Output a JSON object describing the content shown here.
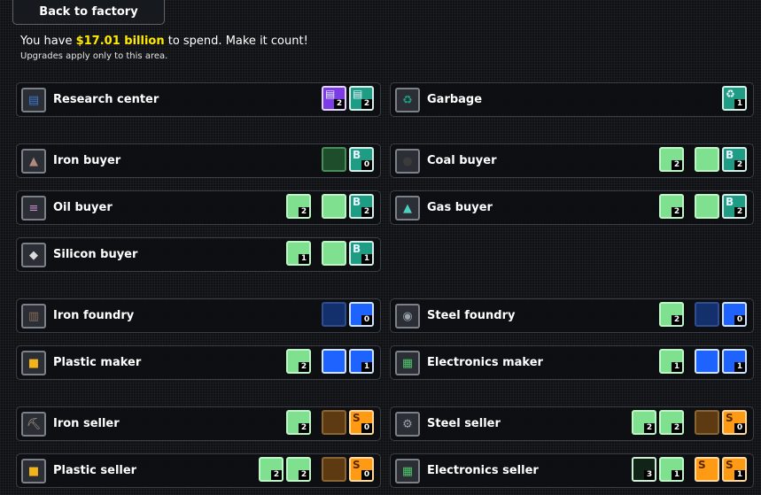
{
  "back_button": "Back to factory",
  "budget": {
    "prefix": "You have ",
    "amount": "$17.01 billion",
    "suffix": " to spend. Make it count!",
    "note": "Upgrades apply only to this area."
  },
  "cards": [
    {
      "name": "Research center",
      "icon": "research-center-icon",
      "symbol": "▤",
      "color": "#3a78d8",
      "upgrades": [
        {
          "style": "purple",
          "glyph": "▤",
          "badge": "2"
        },
        {
          "style": "teal",
          "glyph": "▤",
          "badge": "2"
        }
      ]
    },
    {
      "name": "Garbage",
      "icon": "recycle-icon",
      "symbol": "♻",
      "color": "#1f9d84",
      "upgrades": [
        {
          "style": "teal",
          "glyph": "♻",
          "badge": "1"
        }
      ]
    },
    {
      "name": "Iron buyer",
      "icon": "iron-ore-icon",
      "symbol": "▲",
      "color": "#b08a7a",
      "upgrades": [
        {
          "style": "dgreen",
          "glyph": "",
          "badge": ""
        },
        {
          "style": "teal",
          "glyph": "B",
          "badge": "0"
        }
      ]
    },
    {
      "name": "Coal buyer",
      "icon": "coal-icon",
      "symbol": "●",
      "color": "#3b3b3b",
      "upgrades": [
        {
          "style": "green",
          "glyph": "",
          "badge": "2"
        },
        {
          "style": "green",
          "glyph": "",
          "badge": "",
          "gap": true
        },
        {
          "style": "teal",
          "glyph": "B",
          "badge": "2"
        }
      ]
    },
    {
      "name": "Oil buyer",
      "icon": "oil-barrel-icon",
      "symbol": "≡",
      "color": "#c48cd0",
      "upgrades": [
        {
          "style": "green",
          "glyph": "",
          "badge": "2"
        },
        {
          "style": "green",
          "glyph": "",
          "badge": "",
          "gap": true
        },
        {
          "style": "teal",
          "glyph": "B",
          "badge": "2"
        }
      ]
    },
    {
      "name": "Gas buyer",
      "icon": "gas-tank-icon",
      "symbol": "▲",
      "color": "#4ed0c0",
      "upgrades": [
        {
          "style": "green",
          "glyph": "",
          "badge": "2"
        },
        {
          "style": "green",
          "glyph": "",
          "badge": "",
          "gap": true
        },
        {
          "style": "teal",
          "glyph": "B",
          "badge": "2"
        }
      ]
    },
    {
      "name": "Silicon buyer",
      "icon": "silicon-icon",
      "symbol": "◆",
      "color": "#dcdcdc",
      "upgrades": [
        {
          "style": "green",
          "glyph": "",
          "badge": "1"
        },
        {
          "style": "green",
          "glyph": "",
          "badge": "",
          "gap": true
        },
        {
          "style": "teal",
          "glyph": "B",
          "badge": "1"
        }
      ]
    },
    {
      "name": "Iron foundry",
      "icon": "iron-foundry-icon",
      "symbol": "▥",
      "color": "#8a6a5a",
      "upgrades": [
        {
          "style": "dblue",
          "glyph": "",
          "badge": ""
        },
        {
          "style": "blue",
          "glyph": "",
          "badge": "0"
        }
      ]
    },
    {
      "name": "Steel foundry",
      "icon": "steel-foundry-icon",
      "symbol": "◉",
      "color": "#9aa3ad",
      "upgrades": [
        {
          "style": "green",
          "glyph": "",
          "badge": "2"
        },
        {
          "style": "dblue",
          "glyph": "",
          "badge": "",
          "gap": true
        },
        {
          "style": "blue",
          "glyph": "",
          "badge": "0"
        }
      ]
    },
    {
      "name": "Plastic maker",
      "icon": "plastic-maker-icon",
      "symbol": "■",
      "color": "#f2b418",
      "upgrades": [
        {
          "style": "green",
          "glyph": "",
          "badge": "2"
        },
        {
          "style": "blue",
          "glyph": "",
          "badge": "",
          "gap": true
        },
        {
          "style": "blue",
          "glyph": "",
          "badge": "1"
        }
      ]
    },
    {
      "name": "Electronics maker",
      "icon": "electronics-maker-icon",
      "symbol": "▦",
      "color": "#4cc46a",
      "upgrades": [
        {
          "style": "green",
          "glyph": "",
          "badge": "1"
        },
        {
          "style": "blue",
          "glyph": "",
          "badge": "",
          "gap": true
        },
        {
          "style": "blue",
          "glyph": "",
          "badge": "1"
        }
      ]
    },
    {
      "name": "Iron seller",
      "icon": "iron-seller-icon",
      "symbol": "⛏",
      "color": "#b0a08a",
      "upgrades": [
        {
          "style": "green",
          "glyph": "",
          "badge": "2"
        },
        {
          "style": "dorange",
          "glyph": "",
          "badge": "",
          "gap": true
        },
        {
          "style": "orange",
          "glyph": "S",
          "badge": "0"
        }
      ]
    },
    {
      "name": "Steel seller",
      "icon": "steel-seller-icon",
      "symbol": "⚙",
      "color": "#9aa3ad",
      "upgrades": [
        {
          "style": "green",
          "glyph": "",
          "badge": "2"
        },
        {
          "style": "green",
          "glyph": "",
          "badge": "2"
        },
        {
          "style": "dorange",
          "glyph": "",
          "badge": "",
          "gap": true
        },
        {
          "style": "orange",
          "glyph": "S",
          "badge": "0"
        }
      ]
    },
    {
      "name": "Plastic seller",
      "icon": "plastic-seller-icon",
      "symbol": "■",
      "color": "#f2b418",
      "upgrades": [
        {
          "style": "green",
          "glyph": "",
          "badge": "2"
        },
        {
          "style": "green",
          "glyph": "",
          "badge": "2"
        },
        {
          "style": "dorange",
          "glyph": "",
          "badge": "",
          "gap": true
        },
        {
          "style": "orange",
          "glyph": "S",
          "badge": "0"
        }
      ]
    },
    {
      "name": "Electronics seller",
      "icon": "electronics-seller-icon",
      "symbol": "▦",
      "color": "#4cc46a",
      "upgrades": [
        {
          "style": "outline",
          "glyph": "",
          "badge": "3"
        },
        {
          "style": "green",
          "glyph": "",
          "badge": "1"
        },
        {
          "style": "orange",
          "glyph": "S",
          "badge": "",
          "gap": true
        },
        {
          "style": "orange",
          "glyph": "S",
          "badge": "1"
        }
      ]
    }
  ]
}
